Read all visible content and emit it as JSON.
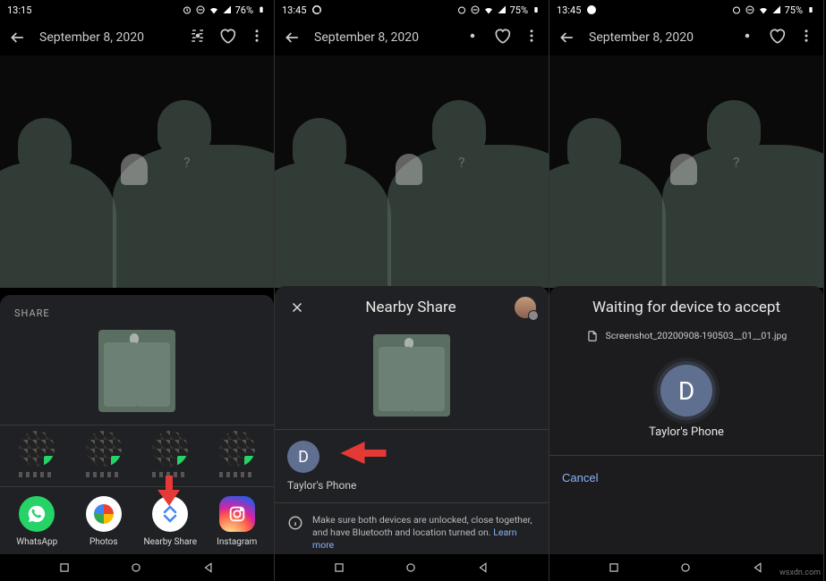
{
  "watermark": "wsxdn.com",
  "screens": [
    {
      "status": {
        "time": "13:15",
        "battery": "76%",
        "has_whatsapp": false
      },
      "appbar": {
        "title": "September 8, 2020"
      },
      "share_panel": {
        "header": "SHARE",
        "apps": [
          {
            "id": "whatsapp",
            "label": "WhatsApp"
          },
          {
            "id": "photos",
            "label": "Photos"
          },
          {
            "id": "nearby",
            "label": "Nearby Share"
          },
          {
            "id": "instagram",
            "label": "Instagram"
          }
        ]
      }
    },
    {
      "status": {
        "time": "13:45",
        "battery": "75%",
        "has_whatsapp": true
      },
      "appbar": {
        "title": "September 8, 2020"
      },
      "nearby": {
        "title": "Nearby Share",
        "device": {
          "initial": "D",
          "name": "Taylor's Phone"
        },
        "info_text": "Make sure both devices are unlocked, close together, and have Bluetooth and location turned on.",
        "learn_more": "Learn more"
      }
    },
    {
      "status": {
        "time": "13:45",
        "battery": "75%",
        "has_whatsapp": true
      },
      "appbar": {
        "title": "September 8, 2020"
      },
      "waiting": {
        "title": "Waiting for device to accept",
        "file": "Screenshot_20200908-190503__01__01.jpg",
        "device": {
          "initial": "D",
          "name": "Taylor's Phone"
        },
        "cancel": "Cancel"
      }
    }
  ]
}
